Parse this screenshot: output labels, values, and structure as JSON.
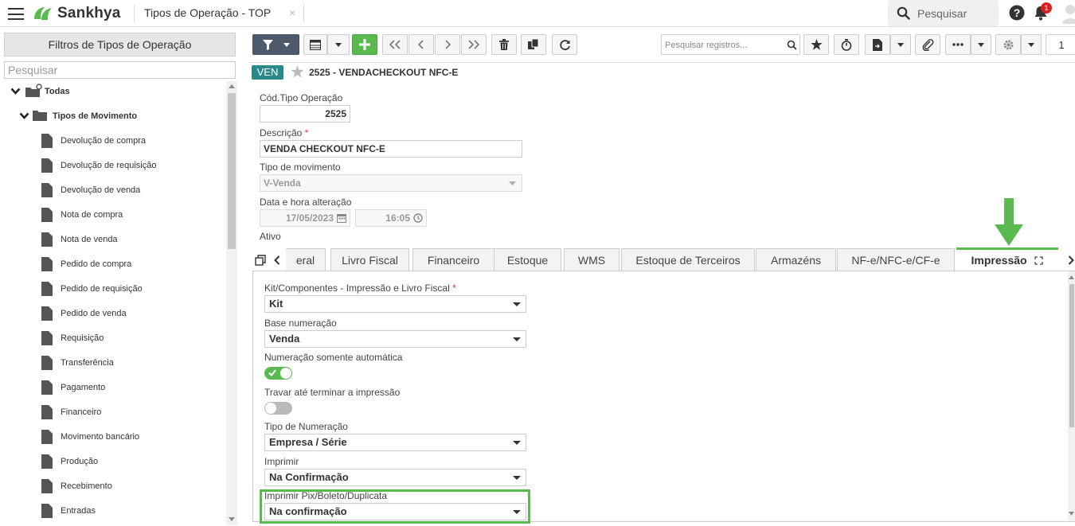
{
  "topbar": {
    "brand": "Sankhya",
    "app_tab": "Tipos de Operação - TOP",
    "tab_close": "×",
    "search_placeholder": "Pesquisar",
    "notifications_count": "1",
    "colors": {
      "brand_green": "#5ab94f",
      "badge_red": "#d9201e"
    }
  },
  "left_panel": {
    "title": "Filtros de Tipos de Operação",
    "search_placeholder": "Pesquisar",
    "tree": {
      "root": "Todas",
      "group": "Tipos de Movimento",
      "items": [
        "Devolução de compra",
        "Devolução de requisição",
        "Devolução de venda",
        "Nota de compra",
        "Nota de venda",
        "Pedido de compra",
        "Pedido de requisição",
        "Pedido de venda",
        "Requisição",
        "Transferência",
        "Pagamento",
        "Financeiro",
        "Movimento bancário",
        "Produção",
        "Recebimento",
        "Entradas"
      ]
    }
  },
  "toolbar": {
    "record_search_placeholder": "Pesquisar registros...",
    "page_number": "1",
    "icons": [
      "filter-icon",
      "grid-icon",
      "add-icon",
      "first-icon",
      "prev-icon",
      "next-icon",
      "last-icon",
      "delete-icon",
      "copy-icon",
      "refresh-icon",
      "search-icon",
      "star-icon",
      "timer-icon",
      "export-icon",
      "attach-icon",
      "more-icon",
      "gear-icon"
    ]
  },
  "record": {
    "badge": "VEN",
    "title": "2525 - VENDACHECKOUT  NFC-E"
  },
  "form": {
    "cod_label": "Cód.Tipo Operação",
    "cod_value": "2525",
    "desc_label": "Descrição",
    "desc_required": "*",
    "desc_value": "VENDA CHECKOUT NFC-E",
    "tipo_mov_label": "Tipo de movimento",
    "tipo_mov_value": "V-Venda",
    "data_label": "Data e hora alteração",
    "date_value": "17/05/2023",
    "time_value": "16:05",
    "ativo_label": "Ativo"
  },
  "tabs": [
    {
      "label": "eral",
      "active": false
    },
    {
      "label": "Livro Fiscal",
      "active": false
    },
    {
      "label": "Financeiro",
      "active": false
    },
    {
      "label": "Estoque",
      "active": false
    },
    {
      "label": "WMS",
      "active": false
    },
    {
      "label": "Estoque de Terceiros",
      "active": false
    },
    {
      "label": "Armazéns",
      "active": false
    },
    {
      "label": "NF-e/NFC-e/CF-e",
      "active": false
    },
    {
      "label": "Impressão",
      "active": true
    }
  ],
  "impressao": {
    "kit_label": "Kit/Componentes - Impressão e Livro Fiscal",
    "kit_required": "*",
    "kit_value": "Kit",
    "base_label": "Base numeração",
    "base_value": "Venda",
    "num_auto_label": "Numeração somente automática",
    "num_auto_on": true,
    "travar_label": "Travar até terminar a impressão",
    "travar_on": false,
    "tipo_num_label": "Tipo de Numeração",
    "tipo_num_value": "Empresa / Série",
    "imprimir_label": "Imprimir",
    "imprimir_value": "Na Confirmação",
    "pix_label": "Imprimir Pix/Boleto/Duplicata",
    "pix_value": "Na confirmação"
  }
}
